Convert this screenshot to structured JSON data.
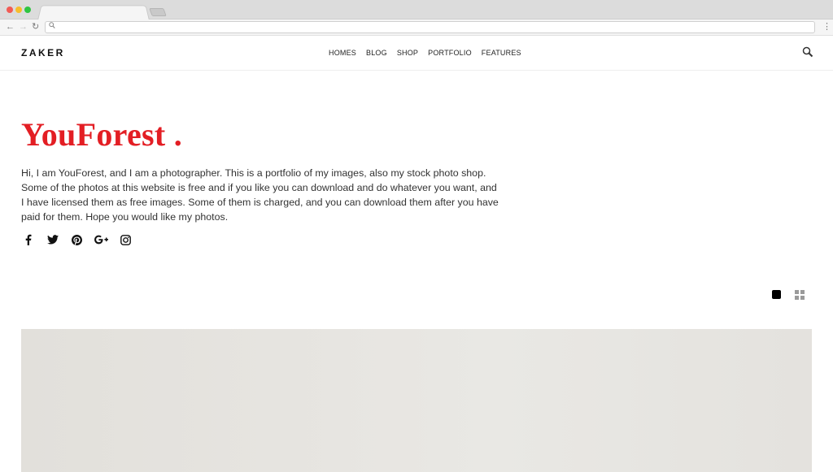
{
  "browser": {
    "back_glyph": "←",
    "forward_glyph": "→",
    "reload_glyph": "↻",
    "menu_glyph": "⋮",
    "url": ""
  },
  "header": {
    "logo": "ZAKER",
    "nav": [
      "HOMES",
      "BLOG",
      "SHOP",
      "PORTFOLIO",
      "FEATURES"
    ],
    "search_icon": "search-icon"
  },
  "hero": {
    "title": "YouForest .",
    "description": "Hi, I am YouForest, and I am a photographer. This is a portfolio of my images, also my stock photo shop. Some of the photos at this website is free and if you like you can download and do whatever you want, and I have licensed them as free images. Some of them is charged, and you can download them after you have paid for them. Hope you would like my photos.",
    "title_color": "#e31e24",
    "socials": [
      "facebook-icon",
      "twitter-icon",
      "pinterest-icon",
      "google-plus-icon",
      "instagram-icon"
    ]
  },
  "view_toggles": {
    "active": "single",
    "options": [
      "single-view-icon",
      "grid-view-icon"
    ]
  }
}
